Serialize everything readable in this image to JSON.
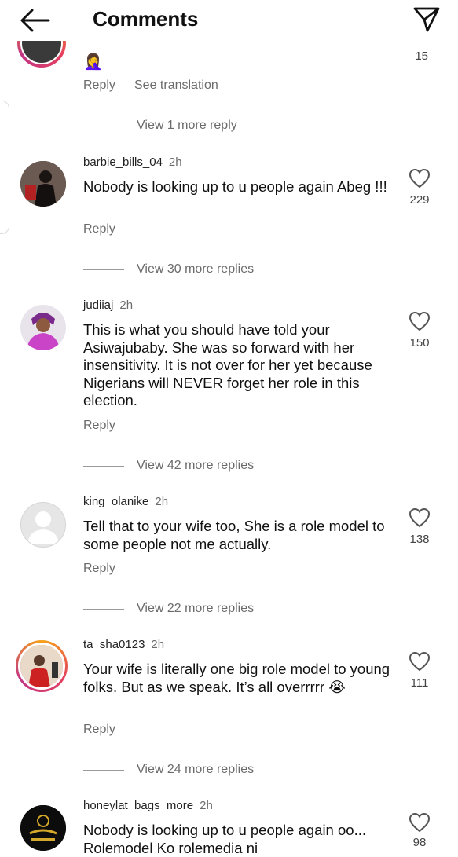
{
  "header": {
    "title": "Comments",
    "back_icon": "arrow-left-icon",
    "send_icon": "paper-plane-icon"
  },
  "top_fragment": {
    "emoji": "🤦‍♀️",
    "likes": "15",
    "reply": "Reply",
    "see_translation": "See translation"
  },
  "first_view_more": "View 1 more reply",
  "comments": [
    {
      "username": "barbie_bills_04",
      "time": "2h",
      "text": "Nobody is looking up to u people again Abeg !!!",
      "likes": "229",
      "reply": "Reply",
      "view_more": "View 30 more replies"
    },
    {
      "username": "judiiaj",
      "time": "2h",
      "text": "This is what you should have told your Asiwajubaby. She was so forward with her insensitivity. It is not over for her yet because Nigerians will NEVER forget her role in this election.",
      "likes": "150",
      "reply": "Reply",
      "view_more": "View 42 more replies"
    },
    {
      "username": "king_olanike",
      "time": "2h",
      "text": "Tell that to your wife too, She is a role model to some people not me actually.",
      "likes": "138",
      "reply": "Reply",
      "view_more": "View 22 more replies"
    },
    {
      "username": "ta_sha0123",
      "time": "2h",
      "text": "Your wife is literally one big role model to young folks. But as we speak. It’s all overrrrr 😭",
      "likes": "111",
      "reply": "Reply",
      "view_more": "View 24 more replies"
    },
    {
      "username": "honeylat_bags_more",
      "time": "2h",
      "text": "Nobody is looking up to u people again oo... Rolemodel Ko rolemedia ni",
      "likes": "98"
    }
  ],
  "colors": {
    "ring_orange": "#f6a21a",
    "ring_pink": "#e4405f",
    "ring_purple": "#c13584",
    "secondary_text": "#6b6b6b"
  }
}
